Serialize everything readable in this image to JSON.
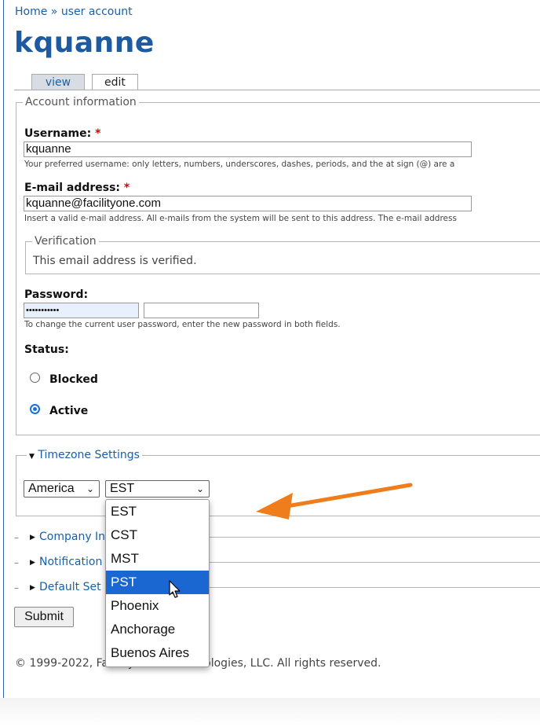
{
  "breadcrumb": {
    "home": "Home",
    "separator": "»",
    "current": "user account"
  },
  "page_title": "kquanne",
  "tabs": [
    {
      "label": "view"
    },
    {
      "label": "edit"
    }
  ],
  "account": {
    "legend": "Account information",
    "username": {
      "label": "Username:",
      "required": "*",
      "value": "kquanne",
      "description": "Your preferred username: only letters, numbers, underscores, dashes, periods, and the at sign (@) are a"
    },
    "email": {
      "label": "E-mail address:",
      "required": "*",
      "value": "kquanne@facilityone.com",
      "description": "Insert a valid e-mail address. All e-mails from the system will be sent to this address. The e-mail address"
    },
    "verification": {
      "legend": "Verification",
      "text": "This email address is verified."
    },
    "password": {
      "label": "Password:",
      "value": "•••••••••••",
      "confirm_value": "",
      "description": "To change the current user password, enter the new password in both fields."
    },
    "status": {
      "label": "Status:",
      "options": [
        "Blocked",
        "Active"
      ],
      "selected": "Active"
    }
  },
  "timezone": {
    "legend": "Timezone Settings",
    "region": "America",
    "zone": "EST",
    "dropdown_options": [
      "EST",
      "CST",
      "MST",
      "PST",
      "Phoenix",
      "Anchorage",
      "Buenos Aires"
    ],
    "highlighted": "PST"
  },
  "collapsed_sections": [
    "Company In",
    "Notification",
    "Default Set"
  ],
  "submit_label": "Submit",
  "footer": "© 1999-2022, FacilityONE® Technologies, LLC. All rights reserved.",
  "colors": {
    "link": "#1a5fa8",
    "title": "#1e5aa0",
    "highlight": "#1a67d2",
    "arrow": "#f07d1c"
  }
}
